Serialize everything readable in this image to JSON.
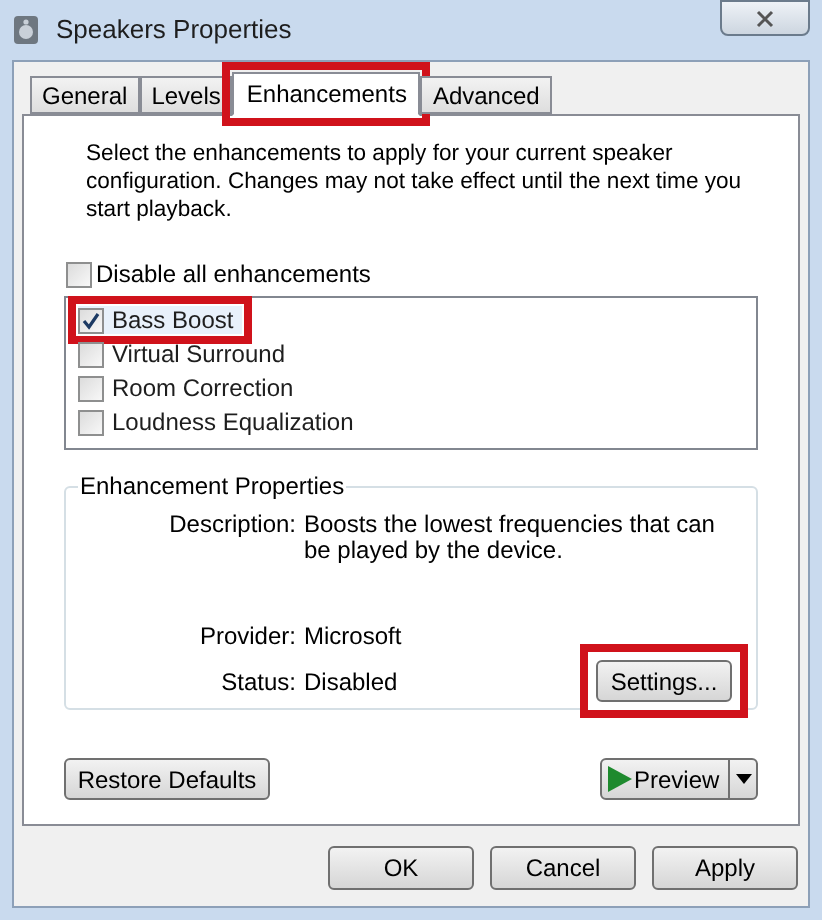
{
  "window": {
    "title": "Speakers Properties"
  },
  "tabs": [
    {
      "label": "General",
      "selected": false,
      "highlighted": false
    },
    {
      "label": "Levels",
      "selected": false,
      "highlighted": false
    },
    {
      "label": "Enhancements",
      "selected": true,
      "highlighted": true
    },
    {
      "label": "Advanced",
      "selected": false,
      "highlighted": false
    }
  ],
  "intro": "Select the enhancements to apply for your current speaker configuration. Changes may not take effect until the next time you start playback.",
  "disable_all": {
    "label": "Disable all enhancements",
    "checked": false
  },
  "enhancements": [
    {
      "label": "Bass Boost",
      "checked": true,
      "selected": true,
      "highlighted": true
    },
    {
      "label": "Virtual Surround",
      "checked": false,
      "selected": false,
      "highlighted": false
    },
    {
      "label": "Room Correction",
      "checked": false,
      "selected": false,
      "highlighted": false
    },
    {
      "label": "Loudness Equalization",
      "checked": false,
      "selected": false,
      "highlighted": false
    }
  ],
  "properties": {
    "title": "Enhancement Properties",
    "fields": [
      {
        "label": "Description:",
        "value": "Boosts the lowest frequencies that can be played by the device."
      },
      {
        "label": "Provider:",
        "value": "Microsoft"
      },
      {
        "label": "Status:",
        "value": "Disabled"
      }
    ],
    "settings_button": {
      "label": "Settings...",
      "highlighted": true
    }
  },
  "restore_button": "Restore Defaults",
  "preview_button": "Preview",
  "buttons": [
    "OK",
    "Cancel",
    "Apply"
  ]
}
